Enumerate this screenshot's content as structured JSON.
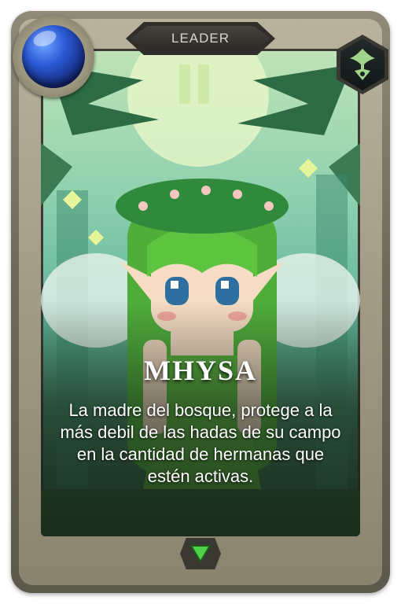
{
  "card": {
    "type_label": "LEADER",
    "name": "MHYSA",
    "description": "La madre del bosque, protege a la más debil de las hadas de su campo en la cantidad de hermanas que estén activas."
  },
  "colors": {
    "frame": "#7a7564",
    "mana_gem": "#2b5bd6",
    "faction_symbol": "#9fd48a",
    "expand_arrow": "#4fd14a"
  },
  "icons": {
    "mana": "mana-orb-icon",
    "faction": "forest-faction-icon",
    "expand": "triangle-down-icon"
  }
}
